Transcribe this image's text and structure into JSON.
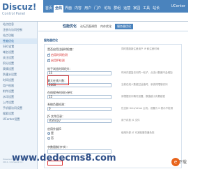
{
  "app": {
    "logo": "Discuz!",
    "subtitle": "Control Panel"
  },
  "nav": {
    "items": [
      "首页",
      "全局",
      "界面",
      "内容",
      "用户",
      "门户",
      "论坛",
      "群组",
      "运营",
      "家园",
      "工具",
      "站长",
      "UCenter"
    ],
    "active": "全局"
  },
  "sidebar": {
    "items": [
      "站点信息",
      "注册与访问控制",
      "站点功能",
      "性能优化",
      "SEO设置",
      "域名设置",
      "关注设置",
      "积分设置",
      "表情设置",
      "防灌水设置",
      "时间设置",
      "用户权限",
      "附件设置",
      "水印设置",
      "上传设置",
      "手机版访问设置",
      "搜索设置",
      "UCenter设置"
    ],
    "active": "性能优化",
    "footer": "Powered by Discuz! X2 © 2001-2011, Comsenz Inc."
  },
  "main": {
    "title": "性能优化",
    "tabs": [
      "论坛页面调用",
      "内存优化",
      "服务器优化"
    ],
    "active_tab": "服务器优化",
    "section": "服务器优化",
    "field_1": {
      "label": "是否启用注册时检查：",
      "checks": [
        {
          "label": "启用时间检测",
          "checked": true
        },
        {
          "label": "启用IP检测",
          "checked": true
        }
      ],
      "hint": "同时限制新注册用户 IP 和注册时间"
    },
    "field_2": {
      "label": "帖子浏览时间(秒)：",
      "value": "15",
      "hint": "时间内重复访问同一帖子，点击计数器不会增加"
    },
    "field_3": {
      "label": "最大在线人数：",
      "value": "5000",
      "hint": "当前在线人数超过此值时，系统将限制访问"
    },
    "field_4": {
      "label": "在线保持时间(分钟)：",
      "value": "15",
      "hint": "请根据访问情况设置，数值越小负载越低"
    },
    "field_5": {
      "label": "系统负载检测：",
      "value": "0",
      "hint": "仅支持 Unix/Linux 主机，设置为 0 表示不检测"
    },
    "field_6": {
      "label": "JS 文件目录：",
      "value": "static/js/",
      "hint": "用于存放 JS 文件"
    },
    "field_7": {
      "label": "启用外部JS",
      "options": [
        {
          "label": "是",
          "checked": true
        },
        {
          "label": "否",
          "checked": false
        }
      ],
      "hint": "使用外部 JS 可减轻服务器负担"
    },
    "field_8": {
      "label": "字数限制(字节)：",
      "value": "",
      "hint": ""
    }
  },
  "watermark": "www.dedecms8.com",
  "badge": "下载"
}
